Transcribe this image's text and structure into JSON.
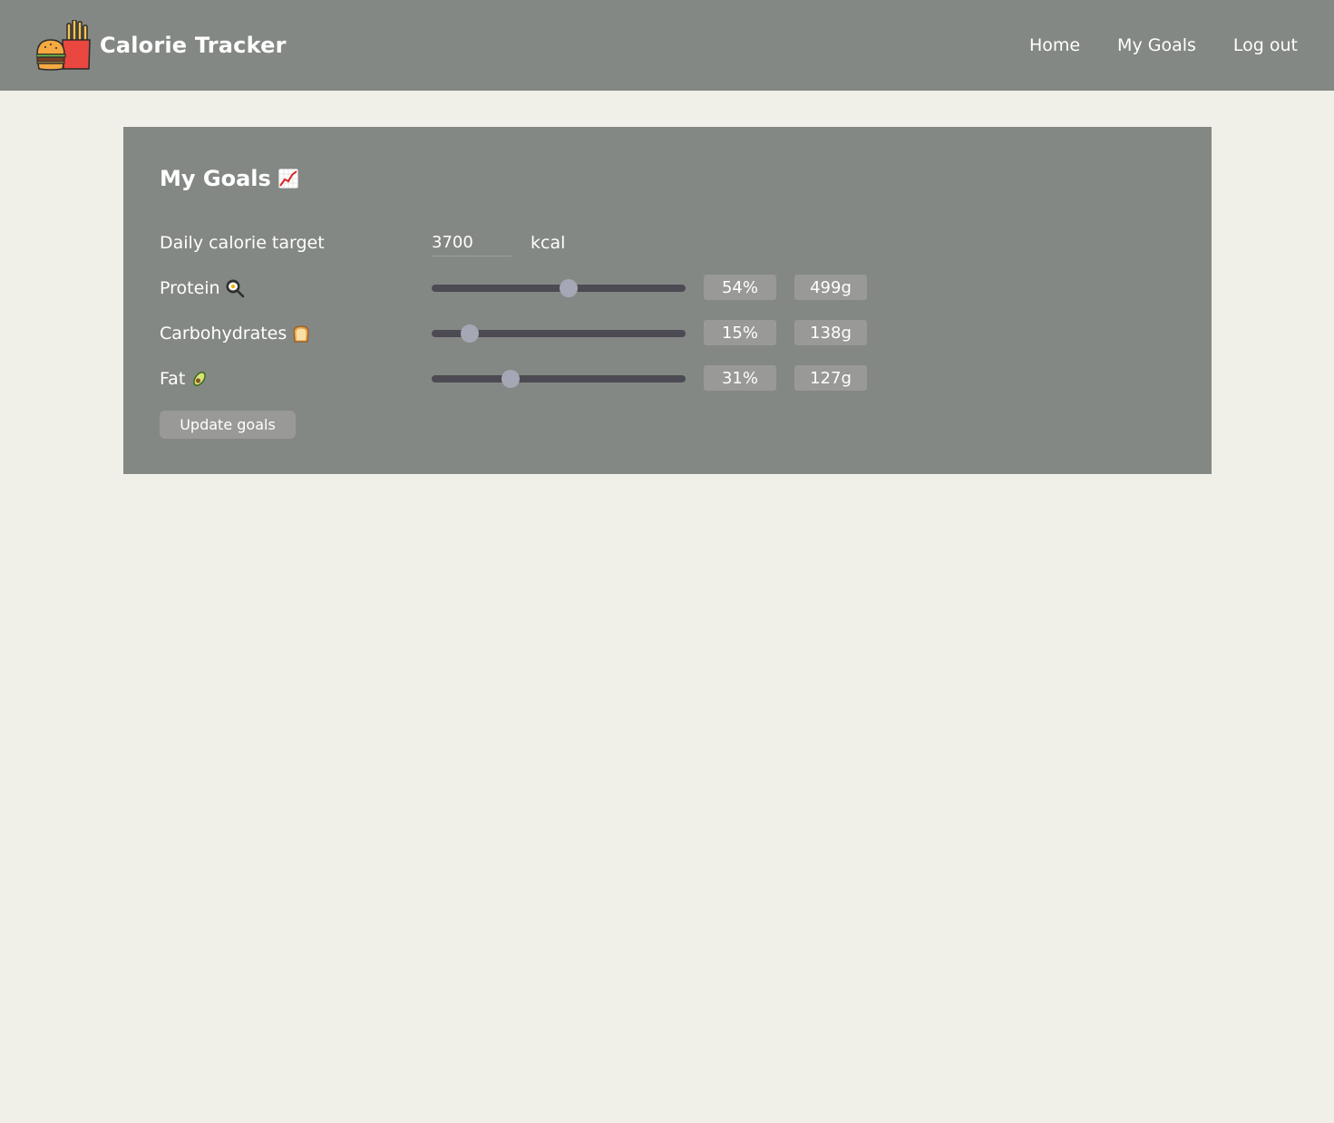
{
  "app": {
    "title": "Calorie Tracker",
    "logo_icon": "burger-and-fries-icon"
  },
  "nav": {
    "items": [
      {
        "label": "Home"
      },
      {
        "label": "My Goals"
      },
      {
        "label": "Log out"
      }
    ]
  },
  "goals": {
    "title": "My Goals",
    "title_icon": "chart-increasing-icon",
    "calorie": {
      "label": "Daily calorie target",
      "value": "3700",
      "unit": "kcal"
    },
    "macros": [
      {
        "label": "Protein",
        "icon": "cooking-egg-icon",
        "percent": 54,
        "percent_label": "54%",
        "grams": "499g"
      },
      {
        "label": "Carbohydrates",
        "icon": "bread-icon",
        "percent": 15,
        "percent_label": "15%",
        "grams": "138g"
      },
      {
        "label": "Fat",
        "icon": "avocado-icon",
        "percent": 31,
        "percent_label": "31%",
        "grams": "127g"
      }
    ],
    "update_label": "Update goals"
  },
  "colors": {
    "page_background": "#f0efe8",
    "panel_background": "#848884",
    "slider_track": "#4c4a52",
    "slider_thumb": "#a6a7b5",
    "badge_background": "#999a97",
    "text": "#ffffff"
  }
}
